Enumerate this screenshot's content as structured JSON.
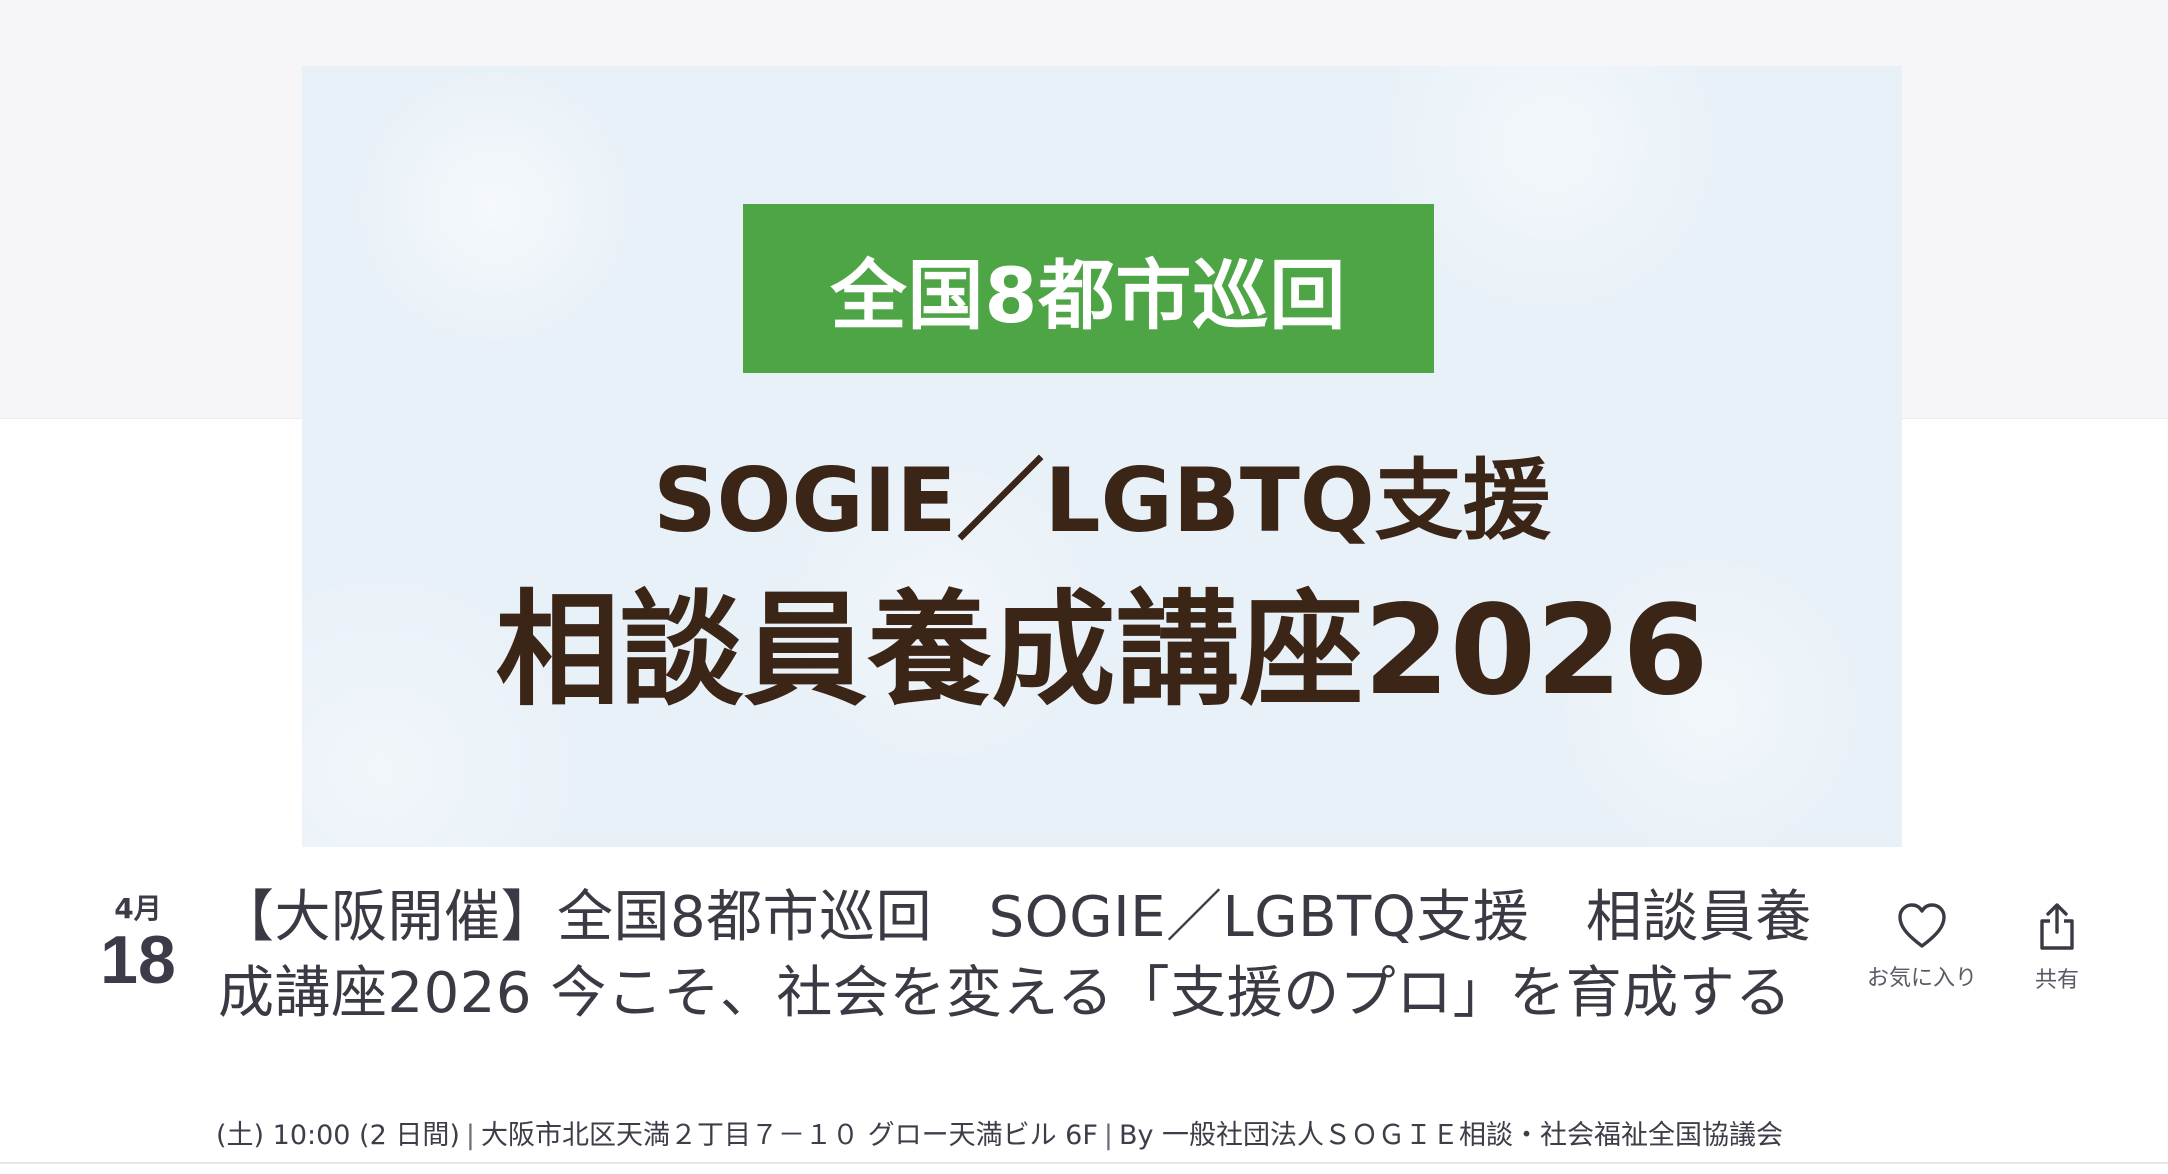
{
  "banner": {
    "tag": "全国8都市巡回",
    "subtitle": "SOGIE／LGBTQ支援",
    "main": "相談員養成講座2026"
  },
  "date": {
    "month": "4月",
    "day": "18"
  },
  "event": {
    "title": "【大阪開催】全国8都市巡回　SOGIE／LGBTQ支援　相談員養成講座2026 今こそ、社会を変える「支援のプロ」を育成する"
  },
  "actions": {
    "like_label": "お気に入り",
    "share_label": "共有"
  },
  "meta": {
    "when": "(土) 10:00 (2 日間)",
    "separator": "|",
    "location": "大阪市北区天満２丁目７－１０ グロー天満ビル 6F",
    "organizer": "By 一般社団法人ＳＯＧＩＥ相談・社会福祉全国協議会"
  },
  "colors": {
    "tag_bg": "#4ea545",
    "banner_text": "#3b2516",
    "banner_bg": "#e9f1f8"
  },
  "icons": {
    "like": "heart-outline-icon",
    "share": "share-upload-icon"
  }
}
